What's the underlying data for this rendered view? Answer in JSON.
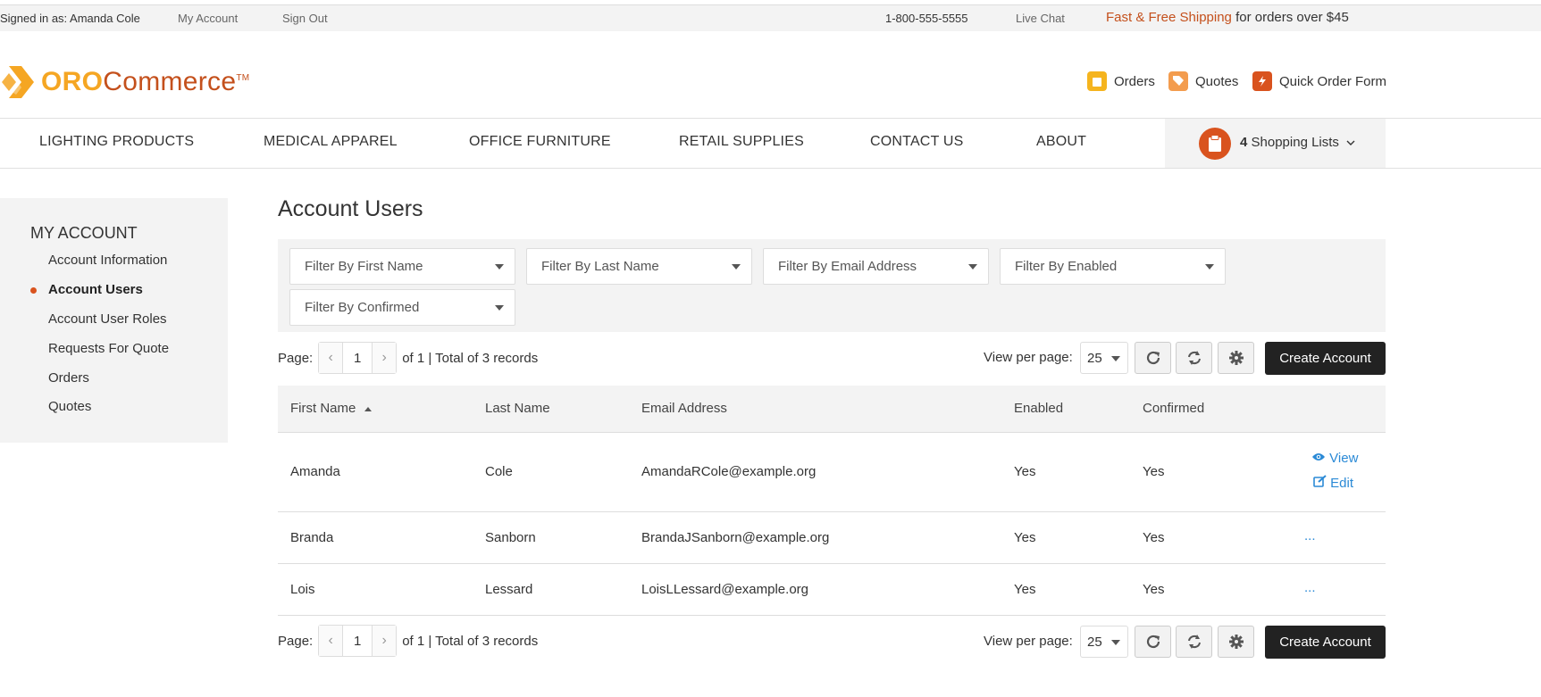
{
  "topbar": {
    "signed_in": "Signed in as: Amanda Cole",
    "my_account": "My Account",
    "sign_out": "Sign Out",
    "phone": "1-800-555-5555",
    "live_chat": "Live Chat",
    "promo_highlight": "Fast & Free Shipping",
    "promo_rest": "for orders over $45"
  },
  "logo": {
    "oro": "ORO",
    "commerce": "Commerce",
    "tm": "TM"
  },
  "quick_links": {
    "orders": "Orders",
    "quotes": "Quotes",
    "quick_order": "Quick Order Form"
  },
  "nav": {
    "items": [
      "LIGHTING PRODUCTS",
      "MEDICAL APPAREL",
      "OFFICE FURNITURE",
      "RETAIL SUPPLIES",
      "CONTACT US",
      "ABOUT"
    ],
    "shopping_count": "4",
    "shopping_label": "Shopping Lists"
  },
  "sidebar": {
    "title": "MY ACCOUNT",
    "items": [
      "Account Information",
      "Account Users",
      "Account User Roles",
      "Requests For Quote",
      "Orders",
      "Quotes"
    ],
    "active_item": "Account Users"
  },
  "main": {
    "title": "Account Users",
    "filters": [
      "Filter By First Name",
      "Filter By Last Name",
      "Filter By Email Address",
      "Filter By Enabled",
      "Filter By Confirmed"
    ],
    "pager": {
      "page_label": "Page:",
      "page_value": "1",
      "page_total": "of 1 | Total of 3 records",
      "view_per_page_label": "View per page:",
      "per_page_value": "25",
      "create_label": "Create Account"
    },
    "table": {
      "columns": [
        "First Name",
        "Last Name",
        "Email Address",
        "Enabled",
        "Confirmed"
      ],
      "rows": [
        {
          "first": "Amanda",
          "last": "Cole",
          "email": "AmandaRCole@example.org",
          "enabled": "Yes",
          "confirmed": "Yes",
          "view": "View",
          "edit": "Edit"
        },
        {
          "first": "Branda",
          "last": "Sanborn",
          "email": "BrandaJSanborn@example.org",
          "enabled": "Yes",
          "confirmed": "Yes",
          "actions": "..."
        },
        {
          "first": "Lois",
          "last": "Lessard",
          "email": "LoisLLessard@example.org",
          "enabled": "Yes",
          "confirmed": "Yes",
          "actions": "..."
        }
      ]
    }
  },
  "colors": {
    "brand_orange": "#f5a623",
    "brand_red": "#c4501c",
    "accent": "#d9531e",
    "link": "#2b8ad6"
  }
}
